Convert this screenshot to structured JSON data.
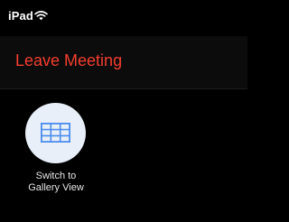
{
  "status_bar": {
    "device": "iPad",
    "wifi_icon": "wifi-icon"
  },
  "header": {
    "leave_label": "Leave Meeting"
  },
  "gallery_toggle": {
    "icon": "grid-icon",
    "label_line1": "Switch to",
    "label_line2": "Gallery View"
  },
  "colors": {
    "background": "#000000",
    "header_background": "#0c0c0c",
    "leave": "#f53d2e",
    "circle": "#e9eff8",
    "grid": "#4a8cf0"
  }
}
